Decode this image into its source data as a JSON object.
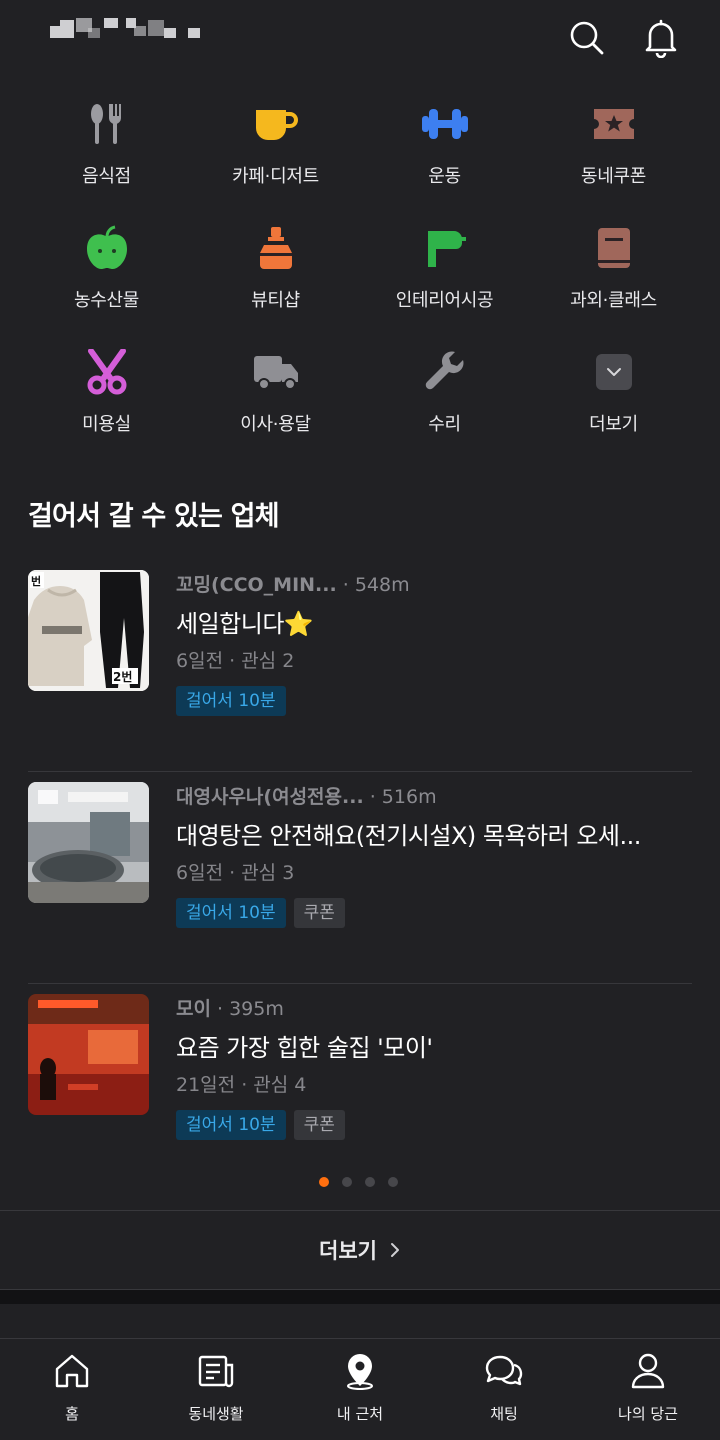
{
  "header": {
    "icons": [
      "search-icon",
      "bell-icon"
    ]
  },
  "categories": [
    {
      "label": "음식점",
      "icon": "fork-knife-icon",
      "color": "#9b9ba0"
    },
    {
      "label": "카페·디저트",
      "icon": "coffee-cup-icon",
      "color": "#f5b81e"
    },
    {
      "label": "운동",
      "icon": "dumbbell-icon",
      "color": "#3d7ff0"
    },
    {
      "label": "동네쿠폰",
      "icon": "ticket-icon",
      "color": "#a0675b"
    },
    {
      "label": "농수산물",
      "icon": "apple-icon",
      "color": "#3fbf4e"
    },
    {
      "label": "뷰티샵",
      "icon": "perfume-icon",
      "color": "#f0763a"
    },
    {
      "label": "인테리어시공",
      "icon": "paint-roller-icon",
      "color": "#2fb34a"
    },
    {
      "label": "과외·클래스",
      "icon": "book-icon",
      "color": "#a0675b"
    },
    {
      "label": "미용실",
      "icon": "scissors-icon",
      "color": "#d45ed8"
    },
    {
      "label": "이사·용달",
      "icon": "truck-icon",
      "color": "#8f8f94"
    },
    {
      "label": "수리",
      "icon": "wrench-icon",
      "color": "#8f8f94"
    },
    {
      "label": "더보기",
      "icon": "chevron-down-icon",
      "color": "#4a4a4f"
    }
  ],
  "section": {
    "title": "걸어서 갈 수 있는 업체"
  },
  "stores": [
    {
      "name": "꼬밍(CCO_MIN...",
      "distance": "· 548m",
      "headline": "세일합니다⭐",
      "time": "6일전",
      "interest": "· 관심 2",
      "walk_badge": "걸어서 10분",
      "coupon_badge": "",
      "thumb_text": [
        "번",
        "2번"
      ]
    },
    {
      "name": "대영사우나(여성전용...",
      "distance": "· 516m",
      "headline": "대영탕은 안전해요(전기시설X) 목욕하러 오세...",
      "time": "6일전",
      "interest": "· 관심 3",
      "walk_badge": "걸어서 10분",
      "coupon_badge": "쿠폰"
    },
    {
      "name": "모이",
      "distance": "· 395m",
      "headline": "요즘 가장 힙한 술집 '모이'",
      "time": "21일전",
      "interest": "· 관심 4",
      "walk_badge": "걸어서 10분",
      "coupon_badge": "쿠폰"
    }
  ],
  "pager": {
    "count": 4,
    "active": 1,
    "active_color": "#ff6f0f"
  },
  "more": {
    "label": "더보기"
  },
  "tabs": [
    {
      "label": "홈",
      "icon": "home-icon"
    },
    {
      "label": "동네생활",
      "icon": "newspaper-icon"
    },
    {
      "label": "내 근처",
      "icon": "map-pin-icon"
    },
    {
      "label": "채팅",
      "icon": "chat-bubbles-icon"
    },
    {
      "label": "나의 당근",
      "icon": "person-icon"
    }
  ]
}
